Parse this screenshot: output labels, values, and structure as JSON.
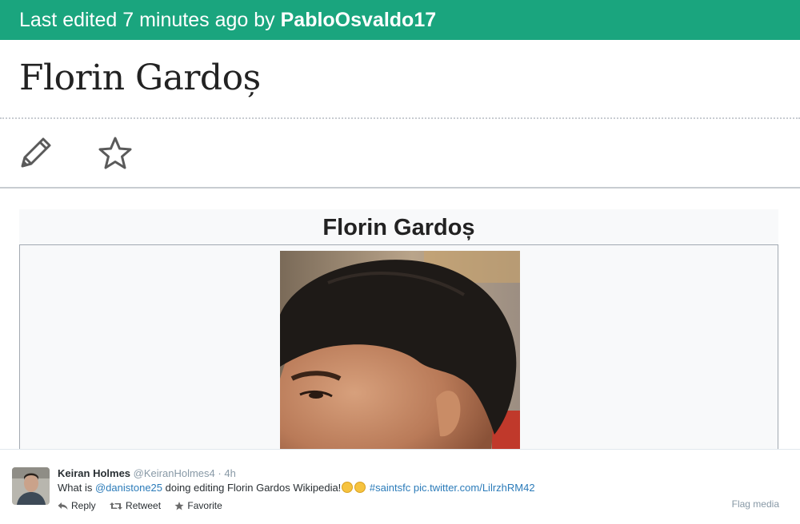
{
  "edit_bar": {
    "prefix": "Last edited 7 minutes ago by ",
    "username": "PabloOsvaldo17"
  },
  "page": {
    "title": "Florin Gardoș",
    "edit_icon": "pencil-icon",
    "watch_icon": "star-icon"
  },
  "infobox": {
    "title": "Florin Gardoș"
  },
  "tweet": {
    "name": "Keiran Holmes",
    "handle": "@KeiranHolmes4",
    "separator": "·",
    "time": "4h",
    "text_1": "What is ",
    "mention": "@danistone25",
    "text_2": " doing editing  Florin Gardos Wikipedia!",
    "hashtag": "#saintsfc",
    "pic_link": "pic.twitter.com/LilrzhRM42",
    "emoji_icon": "laughing-emoji-icon",
    "actions": {
      "reply": "Reply",
      "retweet": "Retweet",
      "favorite": "Favorite"
    },
    "flag_media": "Flag media",
    "link_color": "#2b7bb9"
  },
  "colors": {
    "accent_bar": "#1aa57e"
  }
}
